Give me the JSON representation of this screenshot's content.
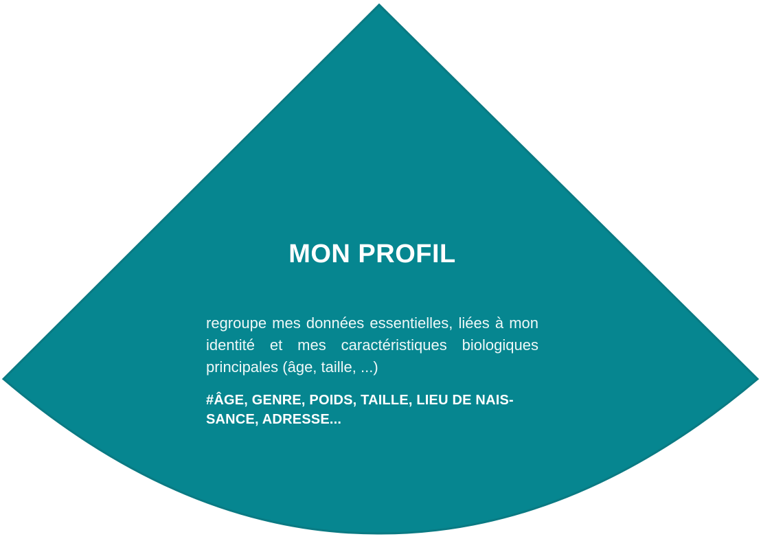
{
  "colors": {
    "sector_fill": "#068690",
    "sector_stroke": "#0a7a83",
    "text": "#ffffff"
  },
  "panel": {
    "title": "MON PROFIL",
    "description": "regroupe mes données essentielles, liées à mon identité et mes caractéristiques biologiques principales (âge, taille, ...)",
    "tags": "#ÂGE, GENRE, POIDS, TAILLE, LIEU DE NAIS- SANCE, ADRESSE..."
  }
}
